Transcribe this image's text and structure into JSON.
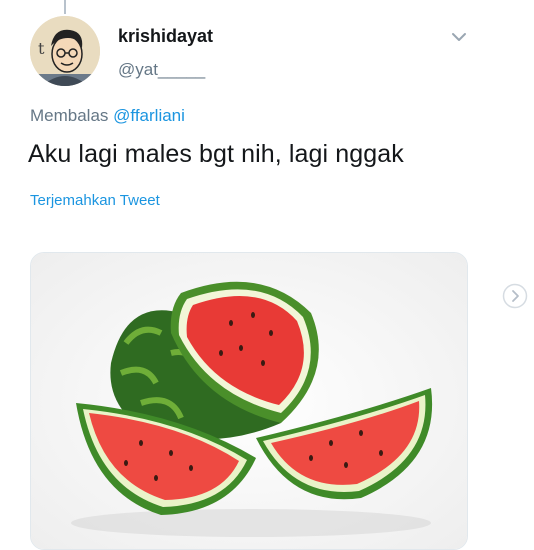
{
  "tweet": {
    "display_name": "krishidayat",
    "handle": "@yat_____",
    "reply_prefix": "Membalas",
    "reply_mention": "@ffarliani",
    "text": "Aku lagi males bgt nih, lagi nggak",
    "translate_label": "Terjemahkan Tweet"
  },
  "icons": {
    "menu": "chevron-down-icon",
    "carousel_next": "chevron-right-icon",
    "avatar_letter": "t"
  },
  "colors": {
    "link": "#1b95e0",
    "secondary_text": "#657786",
    "primary_text": "#14171a"
  }
}
